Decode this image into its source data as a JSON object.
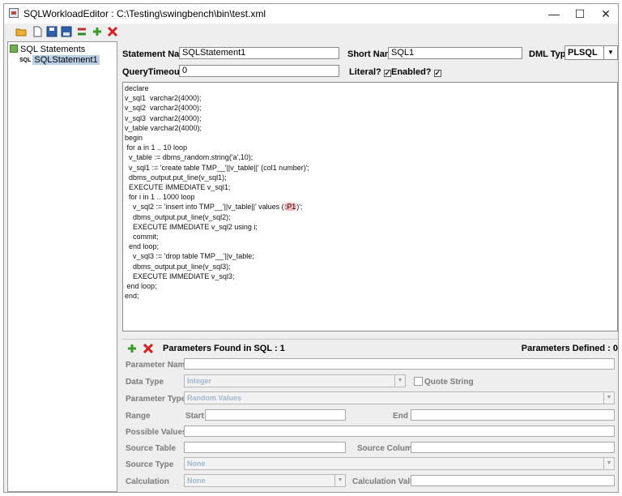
{
  "window": {
    "title": "SQLWorkloadEditor : C:\\Testing\\swingbench\\bin\\test.xml",
    "minimize": "—",
    "maximize": "☐",
    "close": "✕"
  },
  "toolbar": {
    "icons": [
      "open-folder-icon",
      "new-file-icon",
      "save-icon",
      "save-as-icon",
      "move-icon",
      "add-icon",
      "delete-icon"
    ]
  },
  "tree": {
    "root_label": "SQL Statements",
    "child_icon_label": "SQL",
    "child_label": "SQLStatement1"
  },
  "statement": {
    "name_label": "Statement Name",
    "name_value": "SQLStatement1",
    "short_name_label": "Short Name",
    "short_name_value": "SQL1",
    "dml_type_label": "DML Type",
    "dml_type_value": "PLSQL",
    "query_timeout_label": "QueryTimeout",
    "query_timeout_value": "0",
    "literal_label": "Literal?",
    "literal_checked": true,
    "enabled_label": "Enabled?",
    "enabled_checked": true
  },
  "code": {
    "before": "declare\nv_sql1  varchar2(4000);\nv_sql2  varchar2(4000);\nv_sql3  varchar2(4000);\nv_table varchar2(4000);\nbegin\n for a in 1 .. 10 loop\n  v_table := dbms_random.string('a',10);\n  v_sql1 := 'create table TMP__'||v_table||' (col1 number)';\n  dbms_output.put_line(v_sql1);\n  EXECUTE IMMEDIATE v_sql1;\n  for i in 1 .. 1000 loop\n    v_sql2 := 'insert into TMP__'||v_table||' values (",
    "highlight": ":P1",
    "after": ")';\n    dbms_output.put_line(v_sql2);\n    EXECUTE IMMEDIATE v_sql2 using i;\n    commit;\n  end loop;\n    v_sql3 := 'drop table TMP__'||v_table;\n    dbms_output.put_line(v_sql3);\n    EXECUTE IMMEDIATE v_sql3;\n end loop;\nend;"
  },
  "params": {
    "found_label": "Parameters Found in SQL : 1",
    "defined_label": "Parameters Defined : 0",
    "parameter_name_label": "Parameter Name",
    "data_type_label": "Data Type",
    "data_type_value": "Integer",
    "quote_string_label": "Quote String",
    "parameter_type_label": "Parameter Type",
    "parameter_type_value": "Random Values",
    "range_label": "Range",
    "start_label": "Start",
    "end_label": "End",
    "possible_values_label": "Possible Values",
    "source_table_label": "Source Table",
    "source_column_label": "Source Column",
    "source_type_label": "Source Type",
    "source_type_value": "None",
    "calculation_label": "Calculation",
    "calculation_value": "None",
    "calculation_value_label": "Calculation Value"
  },
  "colors": {
    "add_icon": "#3a9a2a",
    "delete_icon": "#d32020",
    "highlight": "#f4b6b6",
    "selection": "#b8cfe5"
  }
}
